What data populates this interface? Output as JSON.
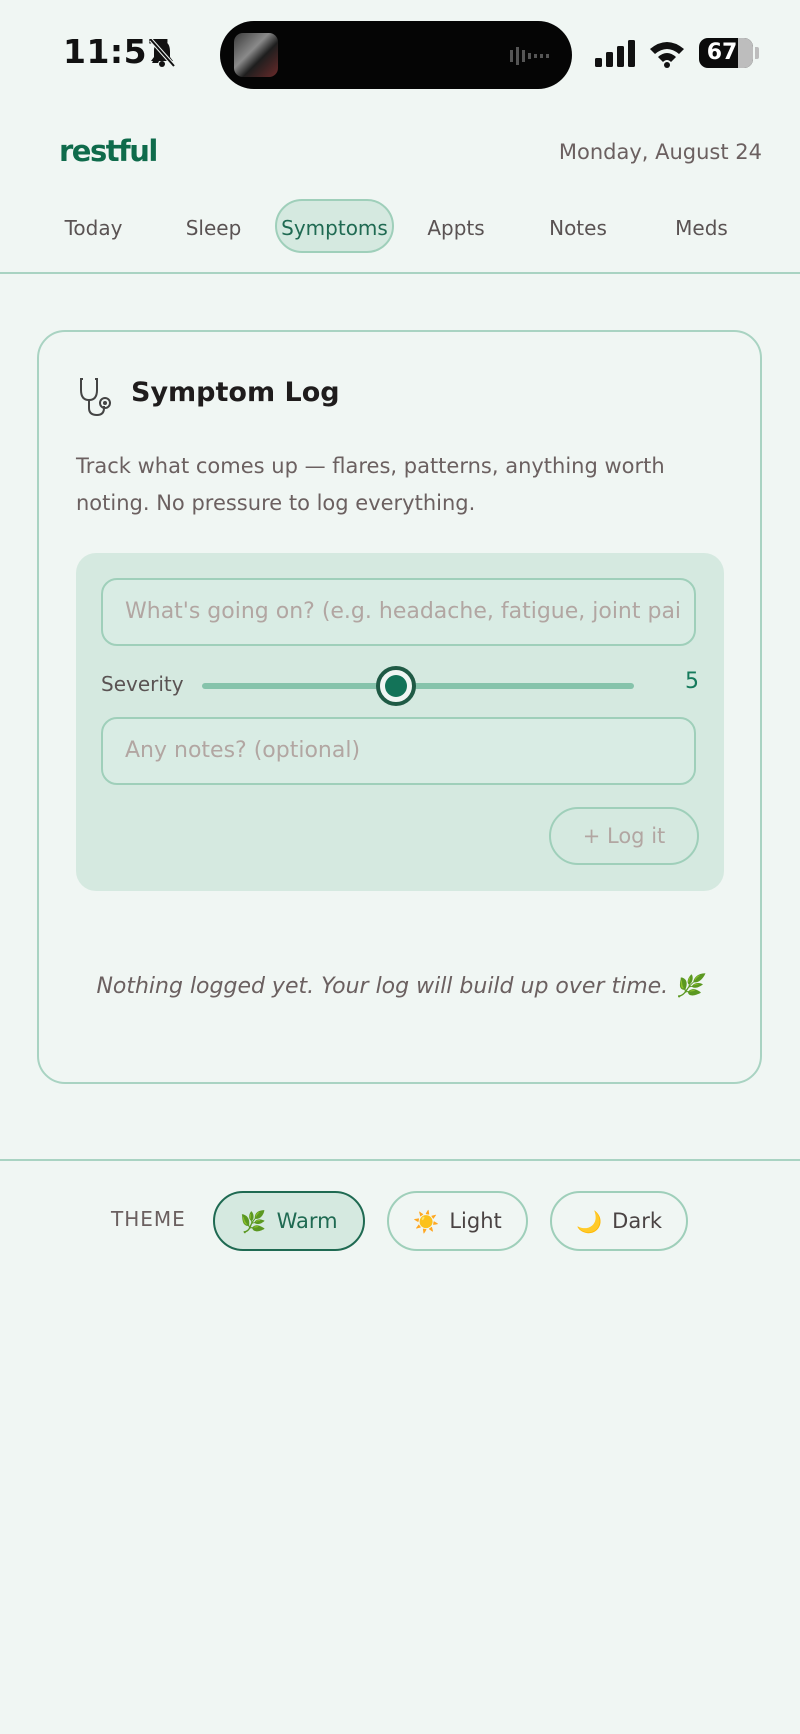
{
  "status_bar": {
    "time": "11:57",
    "battery": "67",
    "icons": [
      "bell-slash-icon",
      "cellular-signal-icon",
      "wifi-icon",
      "battery-icon"
    ]
  },
  "header": {
    "brand": "restful",
    "date": "Monday, August 24"
  },
  "tabs": [
    {
      "label": "Today",
      "active": false
    },
    {
      "label": "Sleep",
      "active": false
    },
    {
      "label": "Symptoms",
      "active": true
    },
    {
      "label": "Appts",
      "active": false
    },
    {
      "label": "Notes",
      "active": false
    },
    {
      "label": "Meds",
      "active": false
    }
  ],
  "symptom_log": {
    "icon": "stethoscope-icon",
    "title": "Symptom Log",
    "description": "Track what comes up — flares, patterns, anything worth noting. No pressure to log everything.",
    "symptom_placeholder": "What's going on? (e.g. headache, fatigue, joint pai",
    "severity_label": "Severity",
    "severity_value": "5",
    "severity_fraction": 0.45,
    "notes_placeholder": "Any notes? (optional)",
    "log_button": "+ Log it",
    "empty_message": "Nothing logged yet. Your log will build up over time. 🌿"
  },
  "theme": {
    "label": "THEME",
    "options": [
      {
        "icon": "🌿",
        "label": "Warm",
        "active": true
      },
      {
        "icon": "☀️",
        "label": "Light",
        "active": false
      },
      {
        "icon": "🌙",
        "label": "Dark",
        "active": false
      }
    ]
  },
  "colors": {
    "background": "#f0f6f3",
    "accent": "#0f6b4b",
    "panel": "#d5e9e0",
    "border": "#a9d3c2"
  }
}
